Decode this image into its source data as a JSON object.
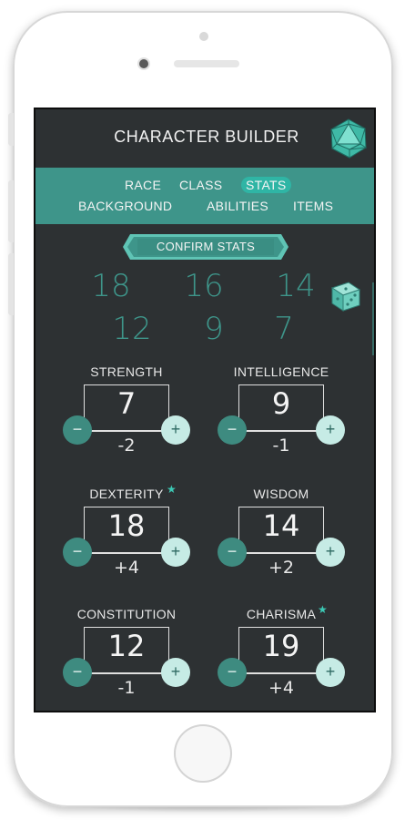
{
  "app": {
    "title": "CHARACTER BUILDER"
  },
  "nav": {
    "race": "RACE",
    "class": "CLASS",
    "stats": "STATS",
    "background": "BACKGROUND",
    "abilities": "ABILITIES",
    "items": "ITEMS",
    "active": "STATS"
  },
  "confirm_label": "CONFIRM STATS",
  "rolls": [
    "18",
    "16",
    "14",
    "12",
    "9",
    "7"
  ],
  "stats": {
    "strength": {
      "label": "STRENGTH",
      "value": "7",
      "modifier": "-2",
      "starred": false
    },
    "intelligence": {
      "label": "INTELLIGENCE",
      "value": "9",
      "modifier": "-1",
      "starred": false
    },
    "dexterity": {
      "label": "DEXTERITY",
      "value": "18",
      "modifier": "+4",
      "starred": true
    },
    "wisdom": {
      "label": "WISDOM",
      "value": "14",
      "modifier": "+2",
      "starred": false
    },
    "constitution": {
      "label": "CONSTITUTION",
      "value": "12",
      "modifier": "-1",
      "starred": false
    },
    "charisma": {
      "label": "CHARISMA",
      "value": "19",
      "modifier": "+4",
      "starred": true
    }
  },
  "buttons": {
    "minus": "−",
    "plus": "+",
    "star": "★"
  },
  "icons": {
    "logo": "d20-icon",
    "dice": "dice-icon"
  },
  "colors": {
    "background": "#2d3133",
    "accent": "#3e958a",
    "accent_active": "#2fb5a5",
    "plus_button": "#c6ebe5",
    "minus_button": "#3e8b80"
  }
}
